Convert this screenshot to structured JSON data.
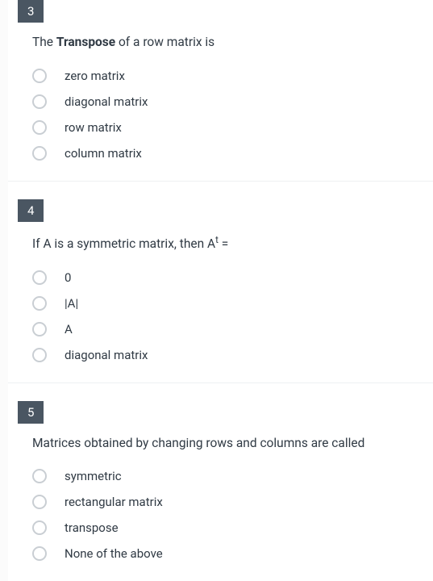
{
  "questions": [
    {
      "number": "3",
      "prompt_html": "The <b>Transpose</b> of a row matrix is",
      "options": [
        "zero matrix",
        "diagonal matrix",
        "row matrix",
        "column matrix"
      ]
    },
    {
      "number": "4",
      "prompt_html": "If A is a symmetric matrix, then A<sup>t</sup> =",
      "options": [
        "0",
        "|A|",
        "A",
        "diagonal matrix"
      ]
    },
    {
      "number": "5",
      "prompt_html": "Matrices obtained by changing rows and columns are called",
      "options": [
        "symmetric",
        "rectangular matrix",
        "transpose",
        "None of the above"
      ]
    }
  ]
}
